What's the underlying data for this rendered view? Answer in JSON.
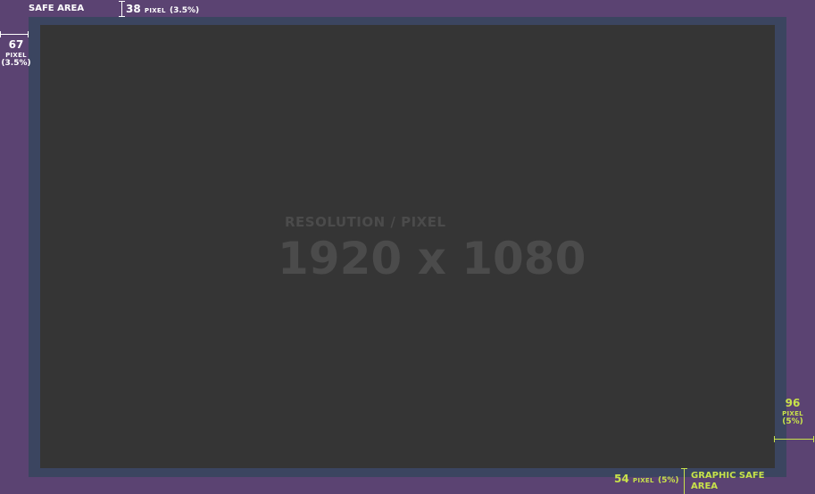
{
  "safe_area": {
    "label": "SAFE AREA"
  },
  "top_margin": {
    "value": "38",
    "unit": "PIXEL",
    "percent": "(3.5%)"
  },
  "left_margin": {
    "value": "67",
    "unit": "PIXEL",
    "percent": "(3.5%)"
  },
  "right_margin": {
    "value": "96",
    "unit": "PIXEL",
    "percent": "(5%)"
  },
  "bottom_margin": {
    "value": "54",
    "unit": "PIXEL",
    "percent": "(5%)"
  },
  "graphic_safe_area": {
    "label_line1": "GRAPHIC SAFE",
    "label_line2": "AREA"
  },
  "resolution": {
    "label": "RESOLUTION / PIXEL",
    "value": "1920 x 1080"
  },
  "colors": {
    "background": "#5b4372",
    "safe_band": "#3b4560",
    "canvas": "#353535",
    "accent_green": "#c8e24a",
    "label_white": "#ffffff"
  }
}
